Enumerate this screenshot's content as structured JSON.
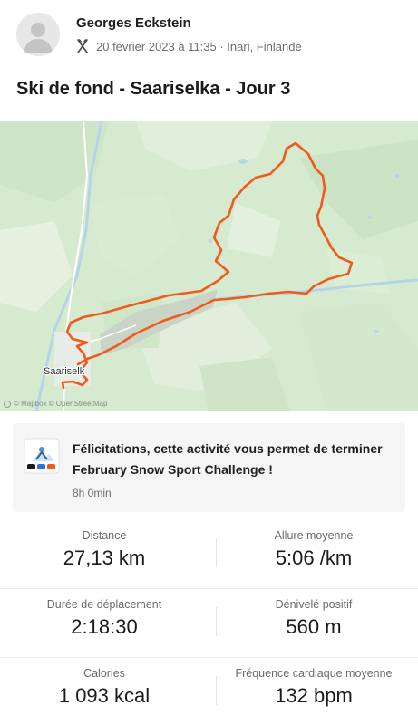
{
  "post": {
    "author": "Georges Eckstein",
    "activity_icon": "cross-country-ski-icon",
    "meta": "20 février 2023 à 11:35 · Inari, Finlande",
    "title": "Ski de fond - Saariselka - Jour 3"
  },
  "map": {
    "town_label": "Saariselk",
    "attribution": "© Mapbox © OpenStreetMap",
    "route_color": "#f05a1a"
  },
  "challenge": {
    "text": "Félicitations, cette activité vous permet de terminer February Snow Sport Challenge !",
    "time": "8h 0min"
  },
  "stats": [
    {
      "left": {
        "label": "Distance",
        "value": "27,13 km"
      },
      "right": {
        "label": "Allure moyenne",
        "value": "5:06 /km"
      }
    },
    {
      "left": {
        "label": "Durée de déplacement",
        "value": "2:18:30"
      },
      "right": {
        "label": "Dénivelé positif",
        "value": "560 m"
      }
    },
    {
      "left": {
        "label": "Calories",
        "value": "1 093 kcal"
      },
      "right": {
        "label": "Fréquence cardiaque moyenne",
        "value": "132 bpm"
      }
    }
  ]
}
